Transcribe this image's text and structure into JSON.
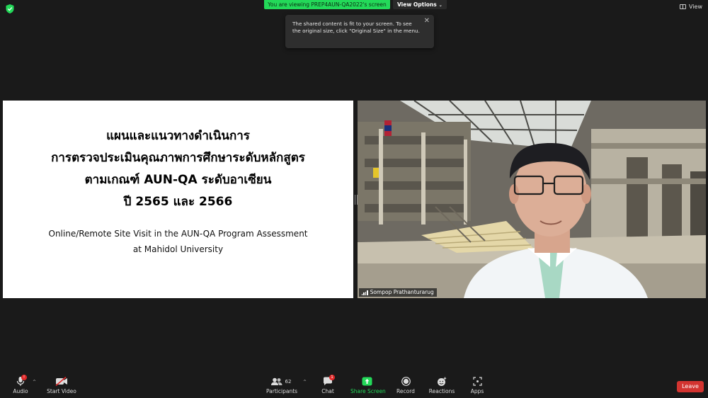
{
  "top_bar": {
    "banner_text": "You are viewing PREP4AUN-QA2022's screen",
    "view_options_label": "View Options",
    "view_label": "View"
  },
  "tooltip": {
    "text": "The shared content is fit to your screen. To see the original size, click \"Original Size\" in the menu."
  },
  "slide": {
    "thai_lines": [
      "แผนและแนวทางดำเนินการ",
      "การตรวจประเมินคุณภาพการศึกษาระดับหลักสูตร",
      "ตามเกณฑ์ AUN-QA ระดับอาเซียน",
      "ปี 2565 และ 2566"
    ],
    "english_lines": [
      "Online/Remote Site Visit in the AUN-QA Program Assessment",
      "at Mahidol University"
    ]
  },
  "video": {
    "participant_name": "Sompop Prathanturarug"
  },
  "toolbar": {
    "audio_label": "Audio",
    "audio_badge": "!",
    "start_video_label": "Start Video",
    "participants_label": "Participants",
    "participants_count": "62",
    "chat_label": "Chat",
    "chat_badge": "1",
    "share_screen_label": "Share Screen",
    "record_label": "Record",
    "reactions_label": "Reactions",
    "apps_label": "Apps",
    "leave_label": "Leave"
  },
  "colors": {
    "banner_green": "#23d959",
    "share_green": "#23d959",
    "leave_red": "#d33430",
    "badge_red": "#e02828"
  }
}
